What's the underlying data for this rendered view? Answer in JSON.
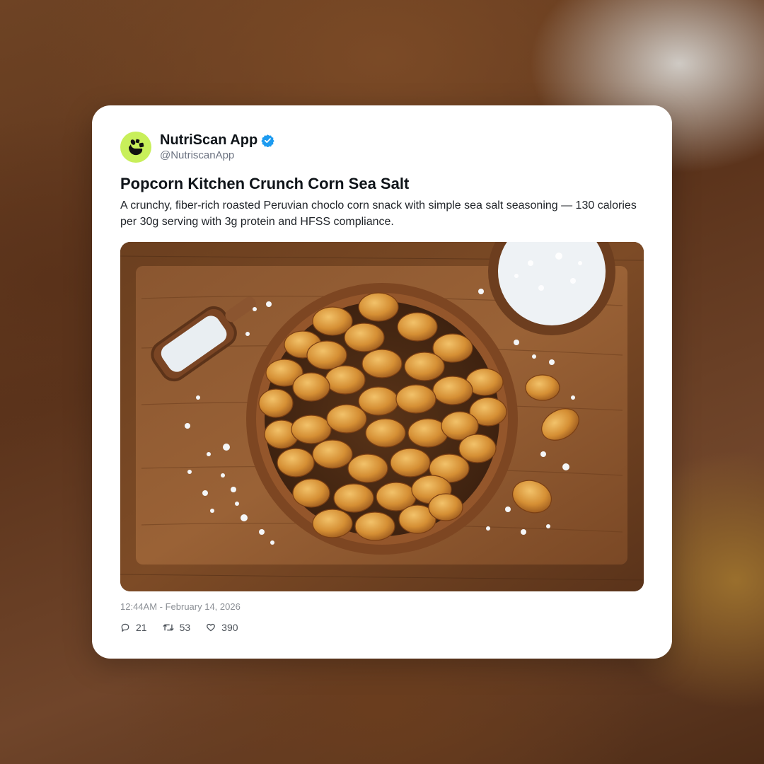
{
  "tweet": {
    "author": {
      "display_name": "NutriScan App",
      "handle": "@NutriscanApp",
      "verified": true,
      "avatar_color": "#c8ef5a"
    },
    "title": "Popcorn Kitchen Crunch Corn Sea Salt",
    "body": "A crunchy, fiber-rich roasted Peruvian choclo corn snack with simple sea salt seasoning — 130 calories per 30g serving with 3g protein and HFSS compliance.",
    "image": {
      "subject": "bowl of roasted corn kernels with sea salt on a wooden board"
    },
    "timestamp": "12:44AM - February 14, 2026",
    "stats": {
      "replies": "21",
      "retweets": "53",
      "likes": "390"
    },
    "icons": {
      "reply": "reply-icon",
      "retweet": "retweet-icon",
      "like": "heart-icon",
      "verified": "verified-badge-icon",
      "avatar": "nutriscan-logo-icon"
    },
    "colors": {
      "verified_blue": "#1d9bf0",
      "card_bg": "#ffffff"
    }
  }
}
